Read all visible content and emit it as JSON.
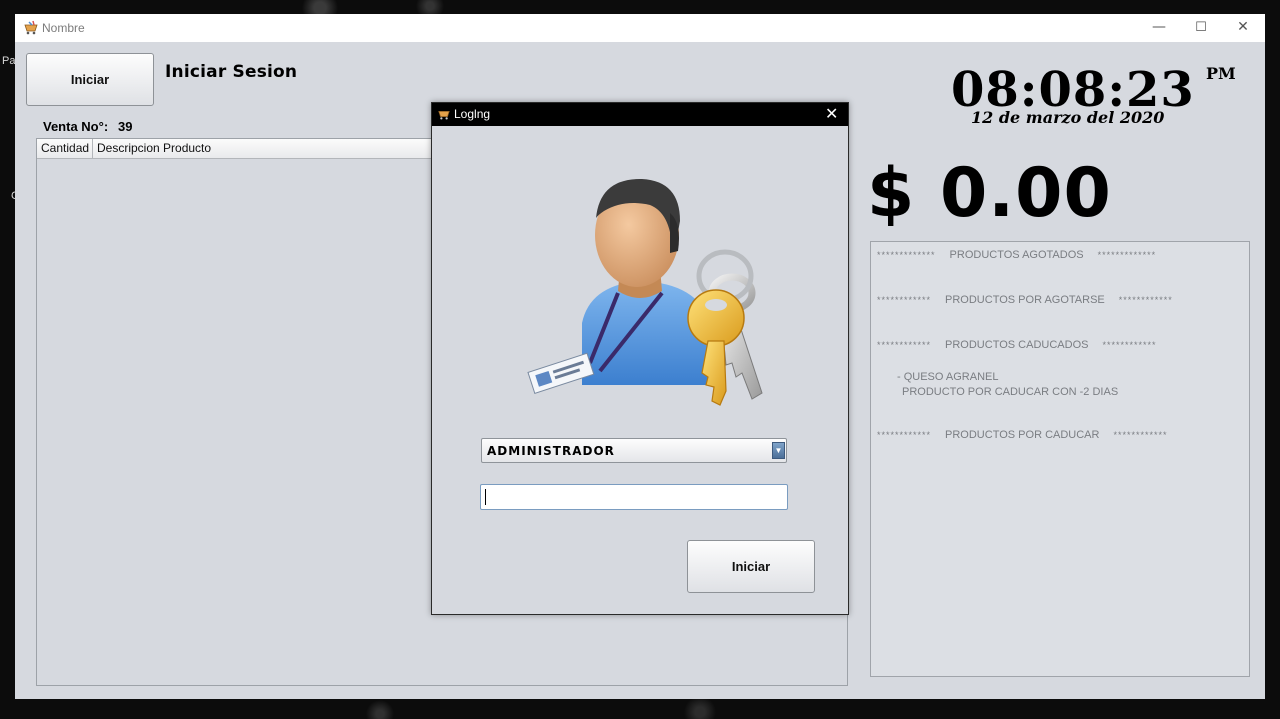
{
  "desktop": {
    "label_1": "Pa",
    "label_2": "C"
  },
  "window": {
    "title": "Nombre",
    "controls": {
      "minimize": "—",
      "maximize": "☐",
      "close": "✕"
    }
  },
  "main": {
    "iniciar_button": "Iniciar",
    "session_title": "Iniciar Sesion",
    "venta_label": "Venta No°:",
    "venta_number": "39",
    "table_columns": [
      "Cantidad",
      "Descripcion Producto"
    ],
    "table_rows": []
  },
  "clock": {
    "time": "08:08:23",
    "ampm": "PM",
    "date": "12 de marzo del 2020"
  },
  "total": "$ 0.00",
  "status_panel": {
    "sections": [
      {
        "title": "PRODUCTOS AGOTADOS",
        "stars_left": "*************",
        "stars_right": "*************"
      },
      {
        "title": "PRODUCTOS POR AGOTARSE",
        "stars_left": "************",
        "stars_right": "************"
      },
      {
        "title": "PRODUCTOS CADUCADOS",
        "stars_left": "************",
        "stars_right": "************"
      },
      {
        "title": "PRODUCTOS POR CADUCAR",
        "stars_left": "************",
        "stars_right": "************"
      }
    ],
    "caducados_items": [
      "- QUESO AGRANEL",
      "PRODUCTO POR CADUCAR CON -2 DIAS"
    ]
  },
  "dialog": {
    "title": "Loglng",
    "close": "✕",
    "user_select": {
      "selected": "ADMINISTRADOR"
    },
    "password": {
      "value": ""
    },
    "iniciar_button": "Iniciar",
    "illustration_icon": "user-with-keys-icon"
  }
}
